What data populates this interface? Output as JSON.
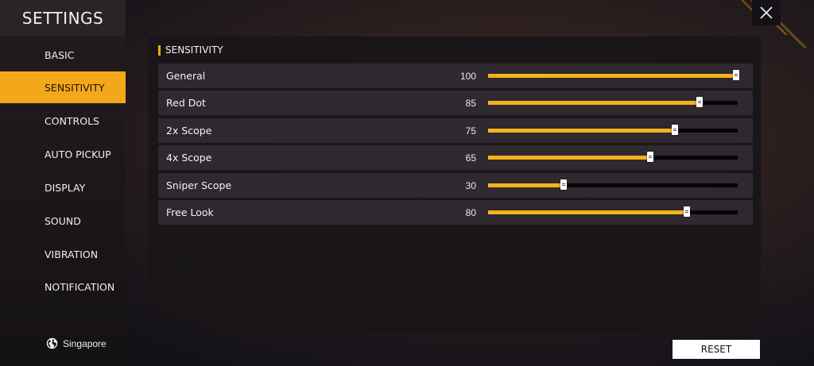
{
  "sidebar": {
    "title": "SETTINGS",
    "items": [
      {
        "label": "BASIC",
        "active": false
      },
      {
        "label": "SENSITIVITY",
        "active": true
      },
      {
        "label": "CONTROLS",
        "active": false
      },
      {
        "label": "AUTO PICKUP",
        "active": false
      },
      {
        "label": "DISPLAY",
        "active": false
      },
      {
        "label": "SOUND",
        "active": false
      },
      {
        "label": "VIBRATION",
        "active": false
      },
      {
        "label": "NOTIFICATION",
        "active": false
      }
    ],
    "region": {
      "label": "Singapore",
      "icon": "globe-icon"
    }
  },
  "main": {
    "section_title": "SENSITIVITY",
    "max": 100,
    "rows": [
      {
        "label": "General",
        "value": "100"
      },
      {
        "label": "Red Dot",
        "value": "85"
      },
      {
        "label": "2x Scope",
        "value": "75"
      },
      {
        "label": "4x Scope",
        "value": "65"
      },
      {
        "label": "Sniper Scope",
        "value": "30"
      },
      {
        "label": "Free Look",
        "value": "80"
      }
    ]
  },
  "actions": {
    "reset_label": "RESET",
    "close_icon": "close-icon"
  },
  "colors": {
    "accent": "#f4a819",
    "slider_fill": "#f4b31c",
    "track": "#050505"
  }
}
